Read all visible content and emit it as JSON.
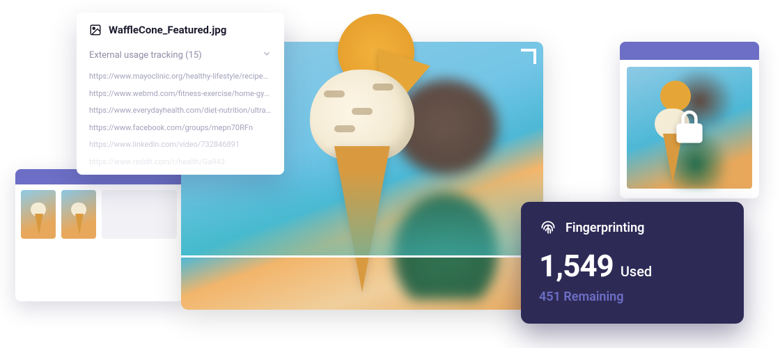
{
  "panel": {
    "filename": "WaffleCone_Featured.jpg",
    "expander_label": "External usage tracking (15)",
    "urls": [
      "https://www.mayoclinic.org/healthy-lifestyle/recipes/lem…",
      "https://www.webmd.com/fitness-exercise/home-gym-ideas",
      "https://www.everydayhealth.com/diet-nutrition/ultra-proc…",
      "https://www.facebook.com/groups/mepn70RFn",
      "https://www.linkedin.com/video/732846891",
      "https://www.reddit.com/r/health/Ga943"
    ]
  },
  "fingerprint": {
    "title": "Fingerprinting",
    "used_count": "1,549",
    "used_label": "Used",
    "remaining": "451 Remaining"
  },
  "icons": {
    "image": "image-icon",
    "chevron": "chevron-down-icon",
    "lock": "lock-icon",
    "fingerprint": "fingerprint-icon",
    "crop_corner": "crop-corner-icon"
  }
}
